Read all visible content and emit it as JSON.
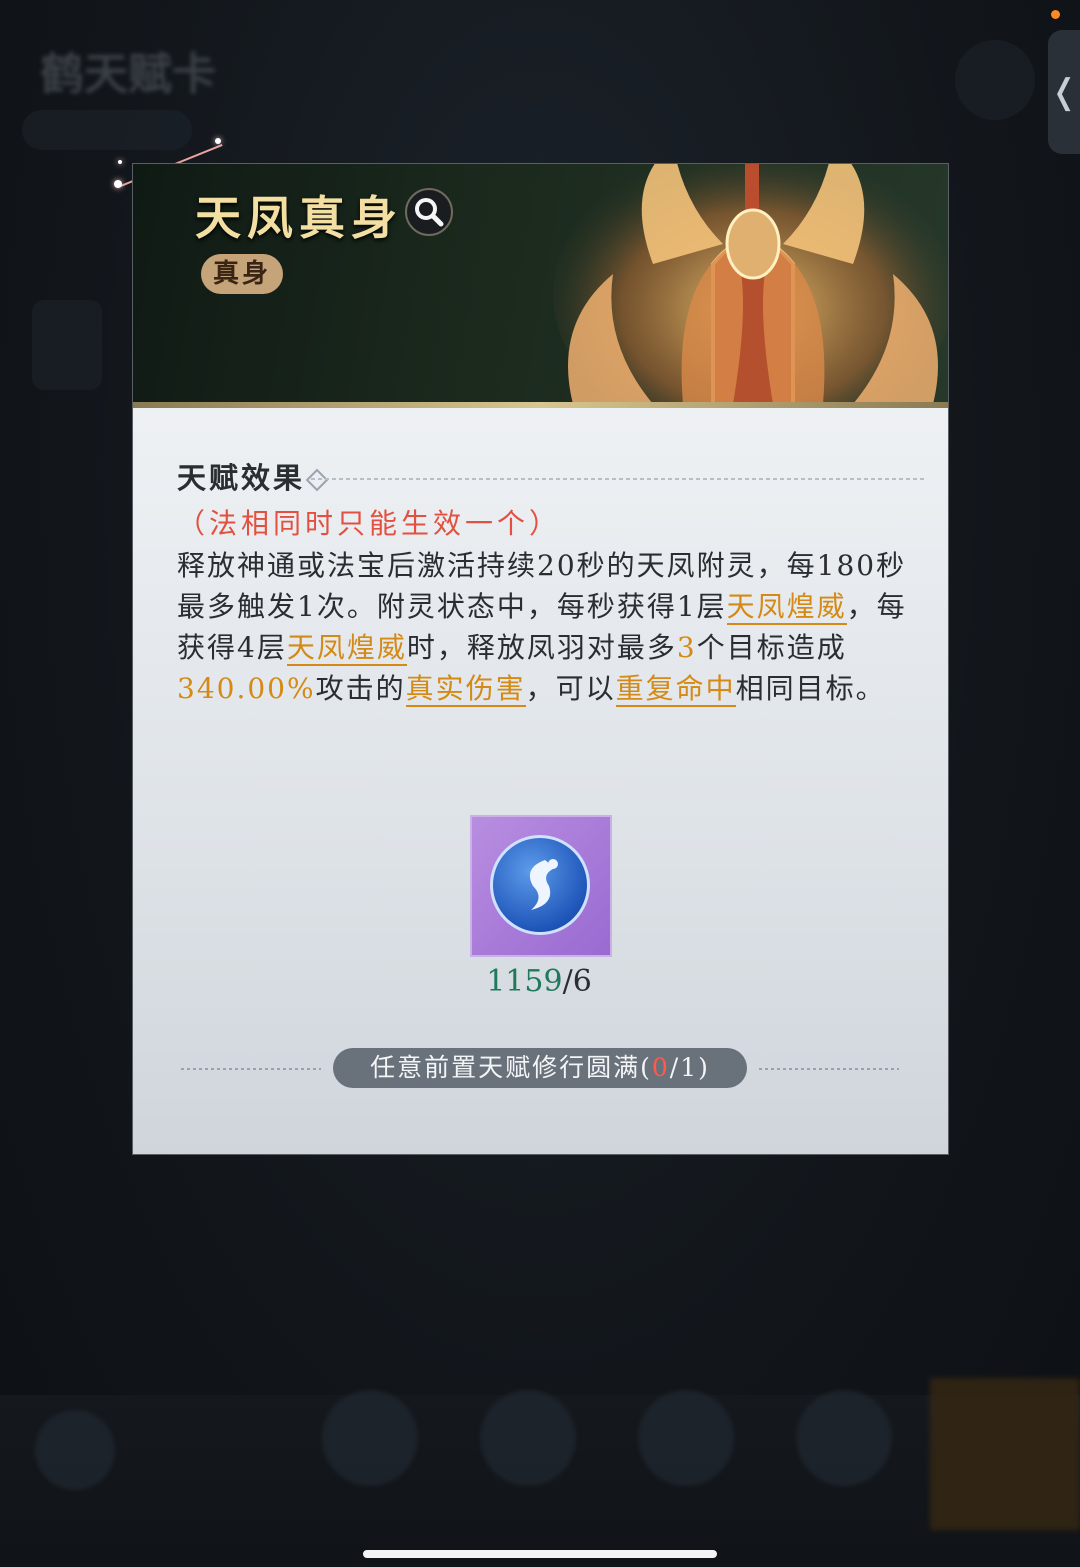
{
  "background": {
    "blurred_title": "鹤天赋卡"
  },
  "card": {
    "title": "天凤真身",
    "tag": "真身",
    "section_title": "天赋效果",
    "note": "（法相同时只能生效一个）",
    "description": {
      "p1": "释放神通或法宝后激活持续20秒的天凤附灵，每180秒最多触发1次。附灵状态中，每秒获得1层",
      "kw1": "天凤煌威",
      "p2": "，每获得4层",
      "kw2": "天凤煌威",
      "p3": "时，释放凤羽对最多",
      "num1": "3",
      "p4": "个目标造成",
      "num2": "340.00%",
      "p5": "攻击的",
      "kw3": "真实伤害",
      "p6": "，可以",
      "kw4": "重复命中",
      "p7": "相同目标。"
    },
    "item": {
      "icon": "swirl-orb-icon",
      "count_have": "1159",
      "count_sep": "/",
      "count_need": "6"
    },
    "requirement": {
      "text": "任意前置天赋修行圆满(",
      "progress": "0",
      "rest": "/1)"
    }
  },
  "colors": {
    "accent_gold": "#d48a14",
    "note_red": "#e25140",
    "count_green": "#1f7a5c"
  }
}
